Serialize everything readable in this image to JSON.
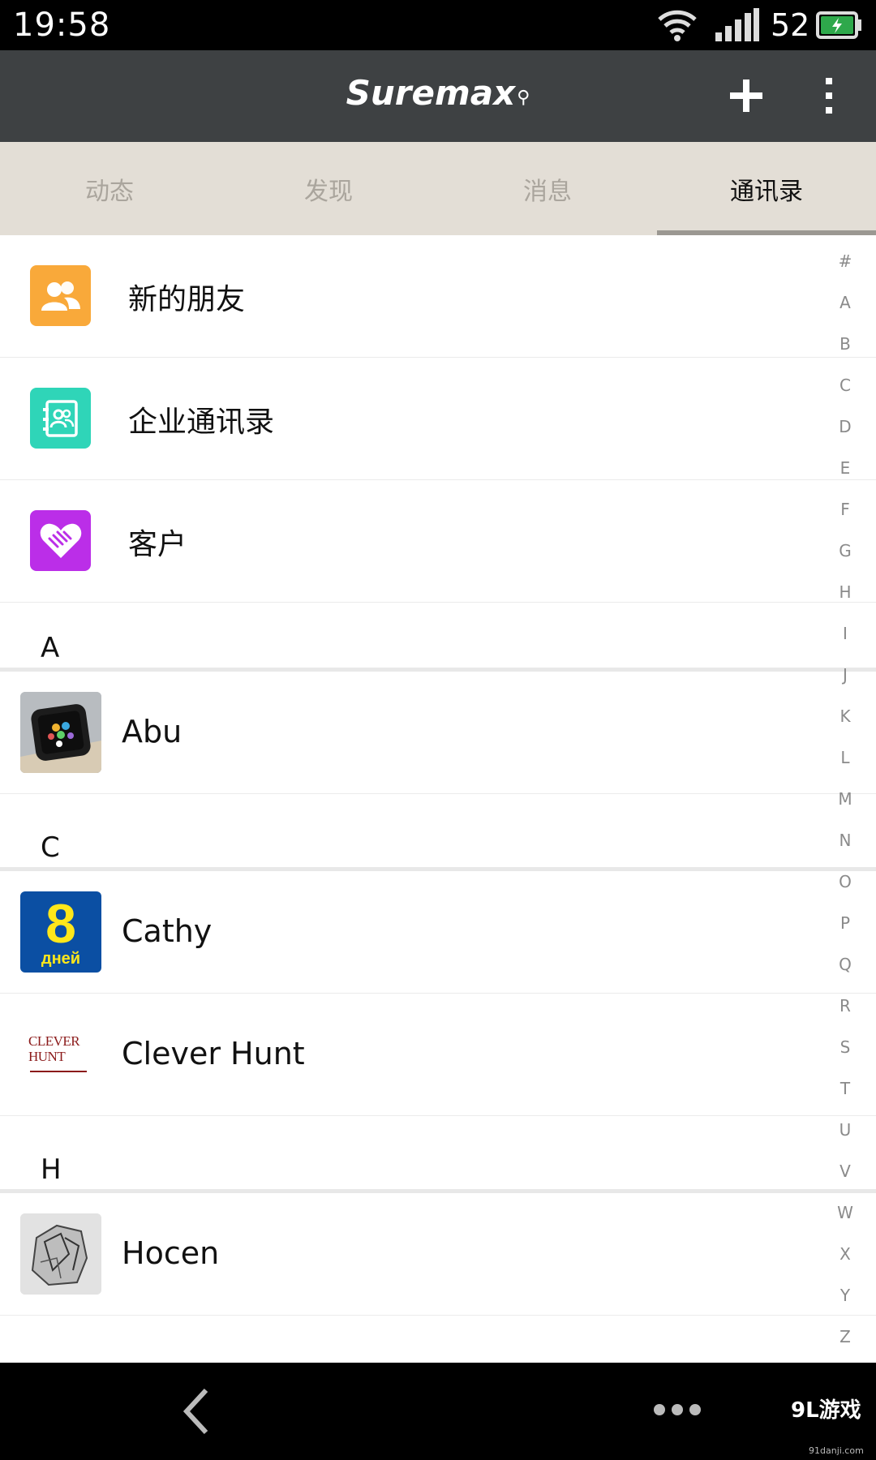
{
  "status_bar": {
    "time": "19:58",
    "battery_level": "52",
    "icons": [
      "wifi-icon",
      "signal-icon",
      "battery-charging-icon"
    ]
  },
  "app_bar": {
    "title": "Suremax",
    "actions": [
      "plus-icon",
      "more-vertical-icon"
    ]
  },
  "tabs": [
    {
      "label": "动态",
      "active": false
    },
    {
      "label": "发现",
      "active": false
    },
    {
      "label": "消息",
      "active": false
    },
    {
      "label": "通讯录",
      "active": true
    }
  ],
  "shortcuts": [
    {
      "label": "新的朋友",
      "icon": "people-icon",
      "color": "#f9a93a"
    },
    {
      "label": "企业通讯录",
      "icon": "address-book-icon",
      "color": "#2fd5b8"
    },
    {
      "label": "客户",
      "icon": "handshake-heart-icon",
      "color": "#bb2ee8"
    }
  ],
  "sections": [
    {
      "letter": "A",
      "contacts": [
        {
          "name": "Abu",
          "avatar": "smartwatch-photo"
        }
      ]
    },
    {
      "letter": "C",
      "contacts": [
        {
          "name": "Cathy",
          "avatar": "8-days-logo",
          "avatar_text": "8",
          "avatar_subtext": "дней"
        },
        {
          "name": "Clever Hunt",
          "avatar": "clever-hunt-logo",
          "avatar_text": "CLEVER HUNT"
        }
      ]
    },
    {
      "letter": "H",
      "contacts": [
        {
          "name": "Hocen",
          "avatar": "sketch-photo"
        }
      ]
    }
  ],
  "index_letters": [
    "#",
    "A",
    "B",
    "C",
    "D",
    "E",
    "F",
    "G",
    "H",
    "I",
    "J",
    "K",
    "L",
    "M",
    "N",
    "O",
    "P",
    "Q",
    "R",
    "S",
    "T",
    "U",
    "V",
    "W",
    "X",
    "Y",
    "Z"
  ],
  "nav_bar": {
    "icons": [
      "back-chevron-icon",
      "more-horizontal-icon"
    ],
    "watermark": "9L游戏",
    "watermark_url": "91danji.com"
  }
}
